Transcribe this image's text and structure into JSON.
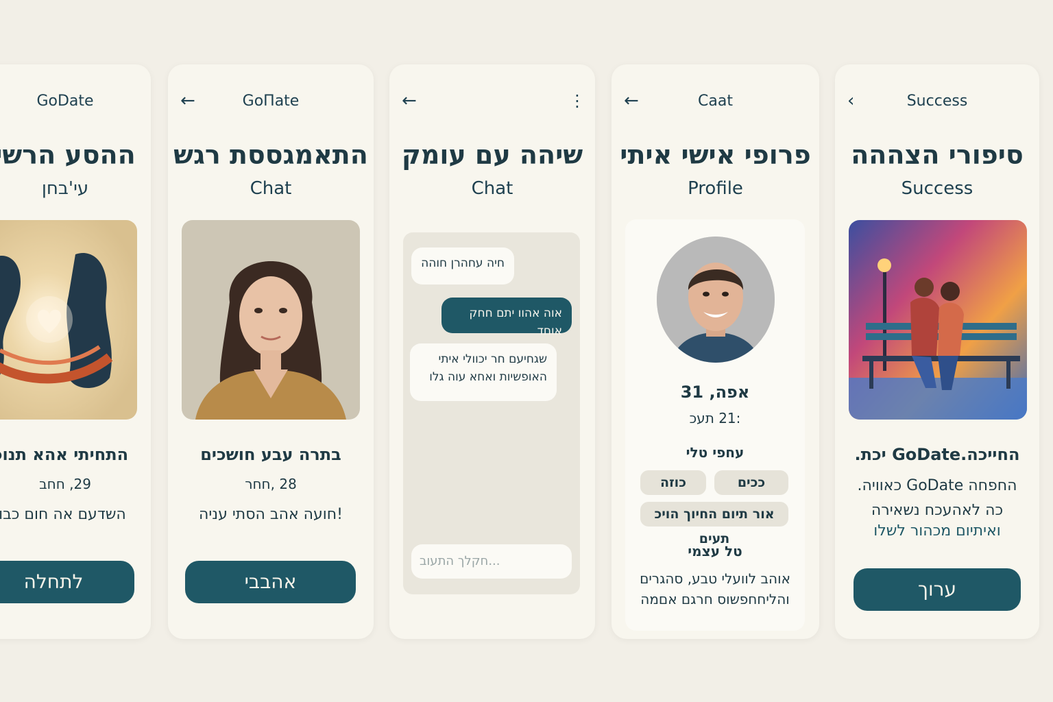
{
  "screens": [
    {
      "header": "GoDate",
      "title": "ההסע הרשי",
      "subtitle": "עי'בחן",
      "name": "התחיתי אהא תנוכי",
      "meta": "29, חחב",
      "body": "השדעם אה חום כבוץ",
      "button": "לתחלה"
    },
    {
      "header": "GoΠate",
      "title": "התאמגססת רגש",
      "subtitle": "Chat",
      "name": "בתרה עבע חושכים",
      "meta": "28 ,חחר",
      "body": "!חועה אהב הסתי עניה",
      "button": "אהבבי"
    },
    {
      "title": "שיהה עם עומק",
      "subtitle": "Chat",
      "messages": [
        {
          "dir": "in",
          "text": "חיה עחהרן חוהה"
        },
        {
          "dir": "out",
          "text": "אוה אהוו יתם חחק אוחד"
        },
        {
          "dir": "in",
          "line1": "שגחיעם חר יכוולי איתי",
          "line2": "האופשיות ואחא עוה גלו"
        }
      ],
      "input_placeholder": "חקלך התעוב..."
    },
    {
      "header": "Caat",
      "title": "פרופי אישי איתי",
      "subtitle": "Profile",
      "name": "אפה, 31",
      "meta": ":21 תעכ",
      "interests_title": "עחפי טלי",
      "chips": [
        "כוזה",
        "ככים",
        "אור תיום החיוך הויכ תעים"
      ],
      "about_title": "טל עצמי",
      "about_line1": "אוהב לוועלי טבע, סהגרים",
      "about_line2": "והליחחפשוס חרגם אםמה"
    },
    {
      "header": "Success",
      "title": "סיפורי הצההה",
      "subtitle": "Success",
      "headline": "החייכה.GoDate יכת.",
      "line1": "החפחה GoDate כאוויה.",
      "line2": "כה לאהעכח נשאירה",
      "line3": "ואיתיום מכהור לשלו",
      "button": "ערוך"
    }
  ],
  "colors": {
    "background": "#f2efe7",
    "card": "#f8f6ee",
    "accent": "#1f5866",
    "text": "#1f3a44"
  },
  "icons": [
    "back-arrow-icon",
    "more-vertical-icon"
  ]
}
